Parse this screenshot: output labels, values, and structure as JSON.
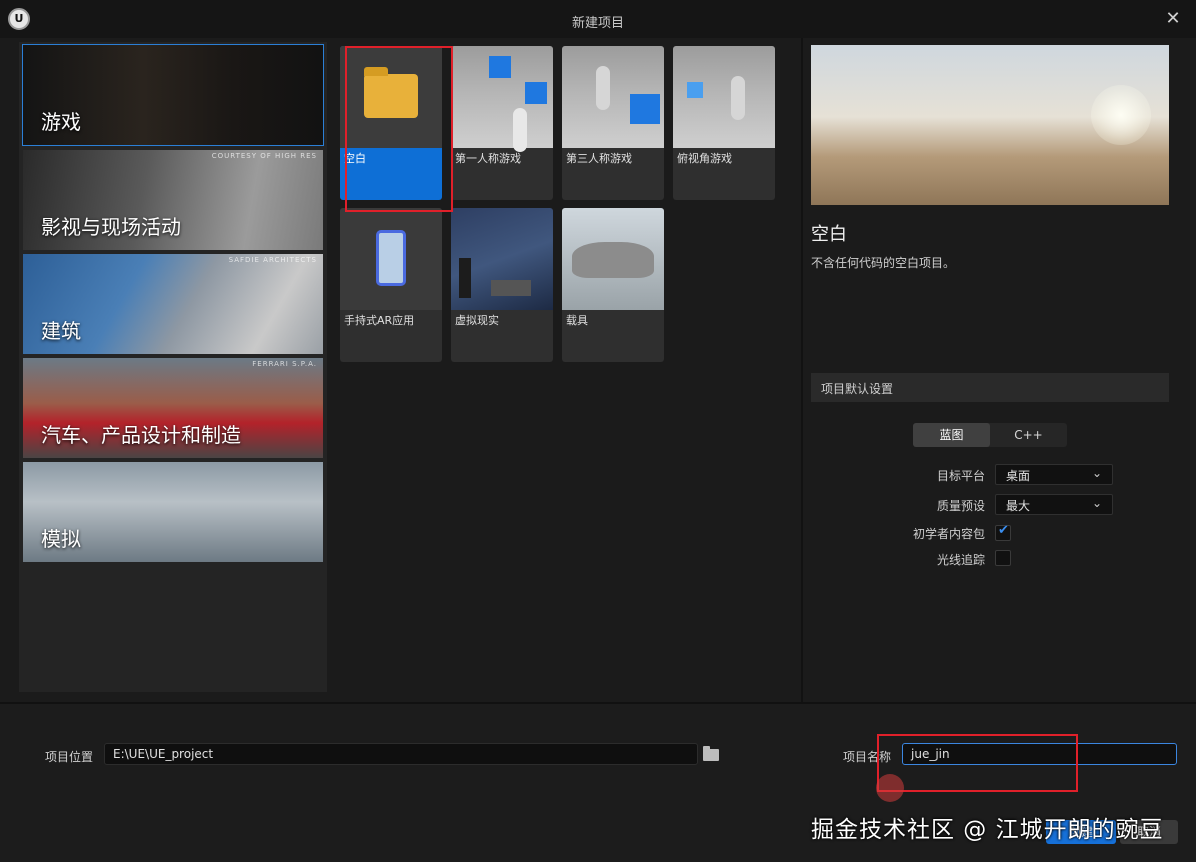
{
  "window": {
    "title": "新建项目",
    "logo_text": "U",
    "close_glyph": "✕"
  },
  "categories": [
    {
      "label": "游戏",
      "credit": "",
      "selected": true
    },
    {
      "label": "影视与现场活动",
      "credit": "COURTESY OF HIGH RES"
    },
    {
      "label": "建筑",
      "credit": "SAFDIE ARCHITECTS"
    },
    {
      "label": "汽车、产品设计和制造",
      "credit": "FERRARI S.P.A."
    },
    {
      "label": "模拟",
      "credit": ""
    }
  ],
  "templates": [
    {
      "label": "空白",
      "selected": true
    },
    {
      "label": "第一人称游戏"
    },
    {
      "label": "第三人称游戏"
    },
    {
      "label": "俯视角游戏"
    },
    {
      "label": "手持式AR应用"
    },
    {
      "label": "虚拟现实"
    },
    {
      "label": "载具"
    }
  ],
  "detail": {
    "title": "空白",
    "description": "不含任何代码的空白项目。"
  },
  "settings": {
    "header": "项目默认设置",
    "blueprint_label": "蓝图",
    "cpp_label": "C++",
    "target_platform_label": "目标平台",
    "target_platform_value": "桌面",
    "quality_label": "质量预设",
    "quality_value": "最大",
    "starter_content_label": "初学者内容包",
    "starter_content_checked": true,
    "raytracing_label": "光线追踪",
    "raytracing_checked": false,
    "chevron": "⌄",
    "tick": "✔"
  },
  "bottom": {
    "location_label": "项目位置",
    "location_value": "E:\\UE\\UE_project",
    "name_label": "项目名称",
    "name_value": "jue_jin",
    "create_label": "创建",
    "cancel_label": "取消"
  },
  "watermark": "掘金技术社区 @ 江城开朗的豌豆",
  "colors": {
    "accent": "#0e6fd6",
    "highlight_box": "#e0202a",
    "background": "#1b1b1b"
  }
}
